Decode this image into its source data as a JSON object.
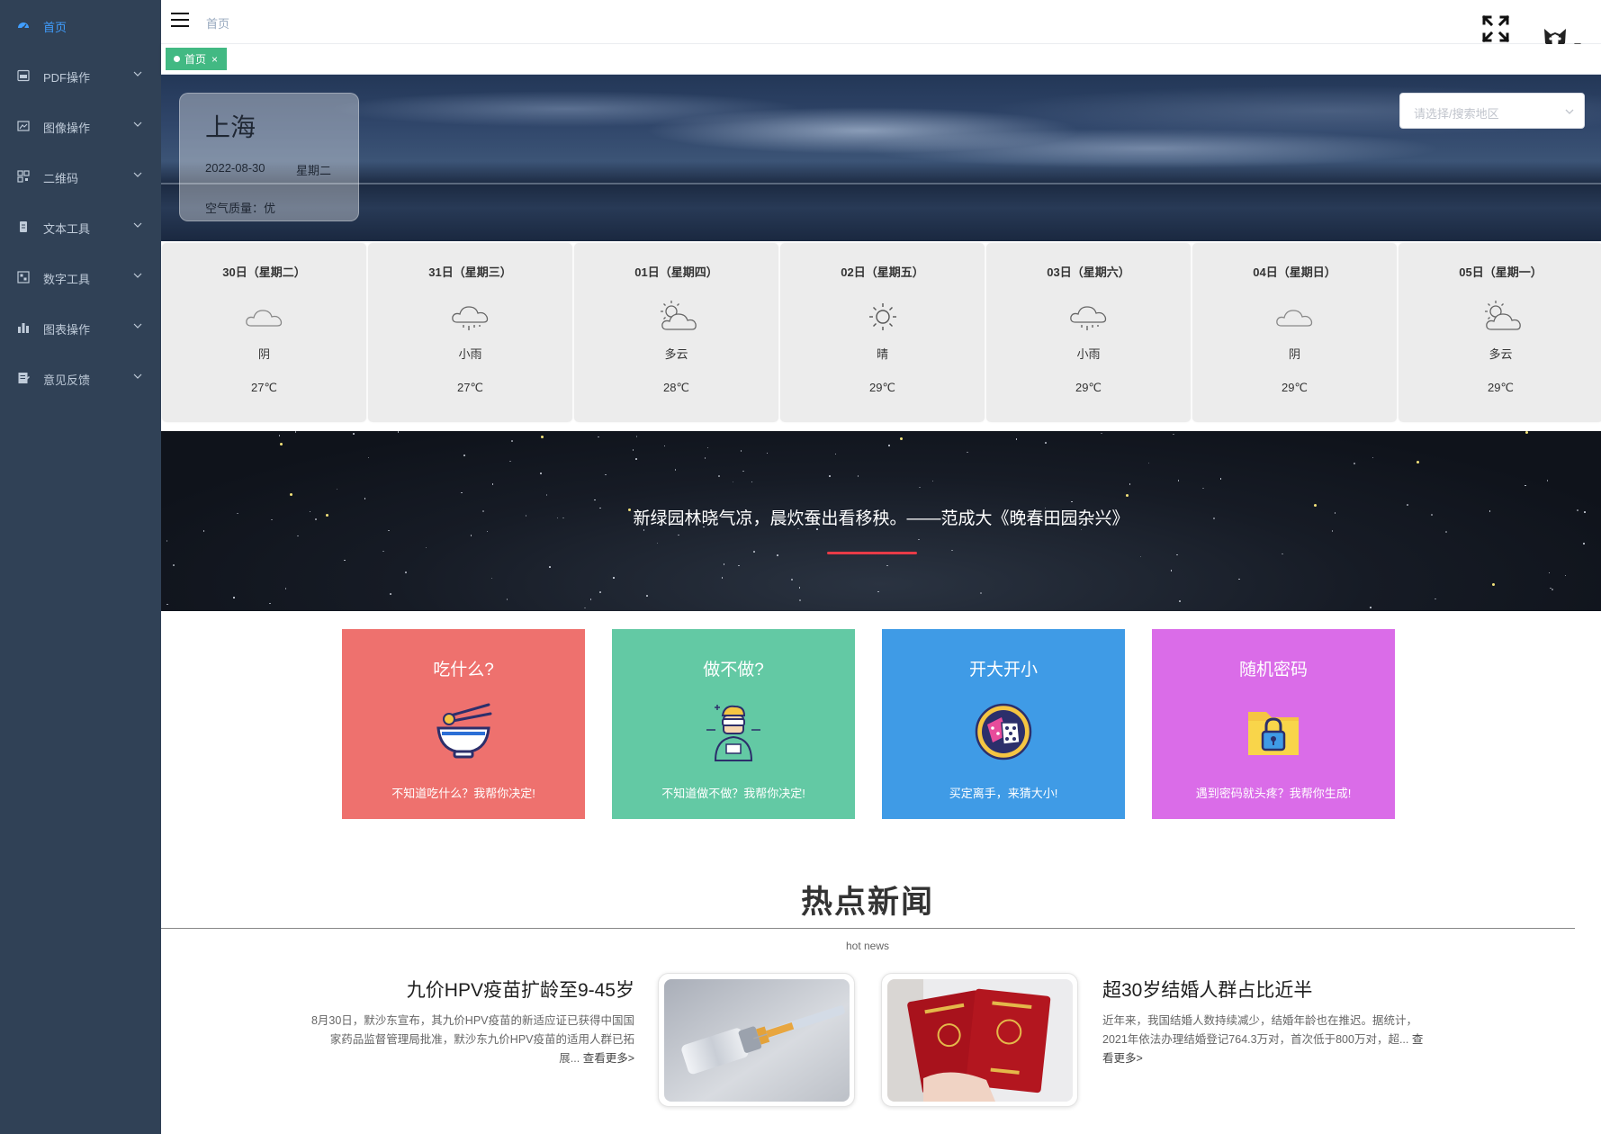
{
  "sidebar": {
    "items": [
      {
        "label": "首页",
        "icon": "dashboard-icon",
        "active": true
      },
      {
        "label": "PDF操作",
        "icon": "pdf-icon"
      },
      {
        "label": "图像操作",
        "icon": "image-icon"
      },
      {
        "label": "二维码",
        "icon": "qrcode-icon"
      },
      {
        "label": "文本工具",
        "icon": "text-tool-icon"
      },
      {
        "label": "数字工具",
        "icon": "number-tool-icon"
      },
      {
        "label": "图表操作",
        "icon": "bar-chart-icon"
      },
      {
        "label": "意见反馈",
        "icon": "feedback-icon"
      }
    ]
  },
  "navbar": {
    "breadcrumb": "首页"
  },
  "tags": {
    "active": "首页",
    "close": "×"
  },
  "weather": {
    "city": "上海",
    "date": "2022-08-30",
    "weekday": "星期二",
    "air_quality": "空气质量：优",
    "region_placeholder": "请选择/搜索地区"
  },
  "forecast": [
    {
      "day": "30日（星期二）",
      "desc": "阴",
      "temp": "27℃",
      "icon": "overcast-icon"
    },
    {
      "day": "31日（星期三）",
      "desc": "小雨",
      "temp": "27℃",
      "icon": "light-rain-icon"
    },
    {
      "day": "01日（星期四）",
      "desc": "多云",
      "temp": "28℃",
      "icon": "partly-cloudy-icon"
    },
    {
      "day": "02日（星期五）",
      "desc": "晴",
      "temp": "29℃",
      "icon": "sunny-icon"
    },
    {
      "day": "03日（星期六）",
      "desc": "小雨",
      "temp": "29℃",
      "icon": "light-rain-icon"
    },
    {
      "day": "04日（星期日）",
      "desc": "阴",
      "temp": "29℃",
      "icon": "overcast-icon"
    },
    {
      "day": "05日（星期一）",
      "desc": "多云",
      "temp": "29℃",
      "icon": "partly-cloudy-icon"
    }
  ],
  "poem": {
    "text": "新绿园林晓气凉，晨炊蚕出看移秧。——范成大《晚春田园杂兴》"
  },
  "tools": [
    {
      "title": "吃什么?",
      "desc": "不知道吃什么？我帮你决定!",
      "color": "#ee716e",
      "icon": "noodle-bowl-icon"
    },
    {
      "title": "做不做?",
      "desc": "不知道做不做？我帮你决定!",
      "color": "#63c9a4",
      "icon": "thinker-person-icon"
    },
    {
      "title": "开大开小",
      "desc": "买定离手，来猜大小!",
      "color": "#3f9be6",
      "icon": "dice-icon"
    },
    {
      "title": "随机密码",
      "desc": "遇到密码就头疼？我帮你生成!",
      "color": "#da6ce8",
      "icon": "folder-lock-icon"
    }
  ],
  "news": {
    "title": "热点新闻",
    "subtitle": "hot news",
    "items": [
      {
        "title": "九价HPV疫苗扩龄至9-45岁",
        "body": "8月30日，默沙东宣布，其九价HPV疫苗的新适应证已获得中国国家药品监督管理局批准，默沙东九价HPV疫苗的适用人群已拓展...",
        "more": "查看更多>",
        "image": "vaccine-syringe-photo"
      },
      {
        "title": "超30岁结婚人群占比近半",
        "body": "近年来，我国结婚人数持续减少，结婚年龄也在推迟。据统计，2021年依法办理结婚登记764.3万对，首次低于800万对，超...",
        "more": "查看更多>",
        "image": "marriage-certificate-photo"
      }
    ]
  }
}
